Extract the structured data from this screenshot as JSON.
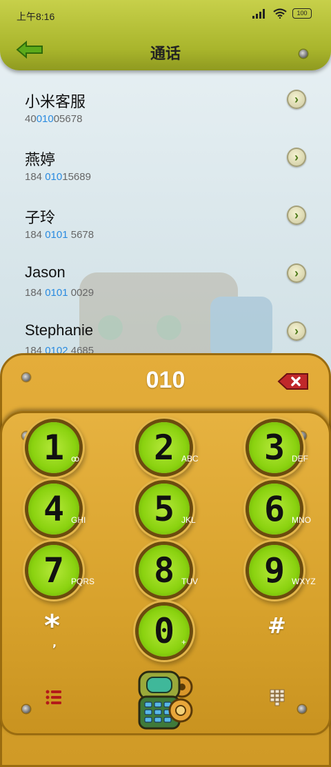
{
  "status": {
    "time": "上午8:16",
    "battery": "100"
  },
  "header": {
    "title": "通话"
  },
  "contacts": [
    {
      "name": "小米客服",
      "num_pre": "40",
      "num_hl": "010",
      "num_post": "05678"
    },
    {
      "name": "燕婷",
      "num_pre": "184 ",
      "num_hl": "010",
      "num_post": "15689"
    },
    {
      "name": "子玲",
      "num_pre": "184 ",
      "num_hl": "0101",
      "num_post": " 5678"
    },
    {
      "name": "Jason",
      "num_pre": "184 ",
      "num_hl": "0101",
      "num_post": " 0029"
    },
    {
      "name": "Stephanie",
      "num_pre": "184 ",
      "num_hl": "0102",
      "num_post": " 4685"
    }
  ],
  "dialer": {
    "input": "010"
  },
  "keys": [
    {
      "digit": "1",
      "sub": "ꝏ"
    },
    {
      "digit": "2",
      "sub": "ABC"
    },
    {
      "digit": "3",
      "sub": "DEF"
    },
    {
      "digit": "4",
      "sub": "GHI"
    },
    {
      "digit": "5",
      "sub": "JKL"
    },
    {
      "digit": "6",
      "sub": "MNO"
    },
    {
      "digit": "7",
      "sub": "PQRS"
    },
    {
      "digit": "8",
      "sub": "TUV"
    },
    {
      "digit": "9",
      "sub": "WXYZ"
    },
    {
      "digit": "0",
      "sub": "+"
    }
  ],
  "star": {
    "symbol": "*",
    "sub": ","
  },
  "hash": {
    "symbol": "#"
  },
  "colors": {
    "header": "#b3bd33",
    "panel": "#dca530",
    "key": "#8ad20f",
    "highlight": "#2a8be0"
  }
}
